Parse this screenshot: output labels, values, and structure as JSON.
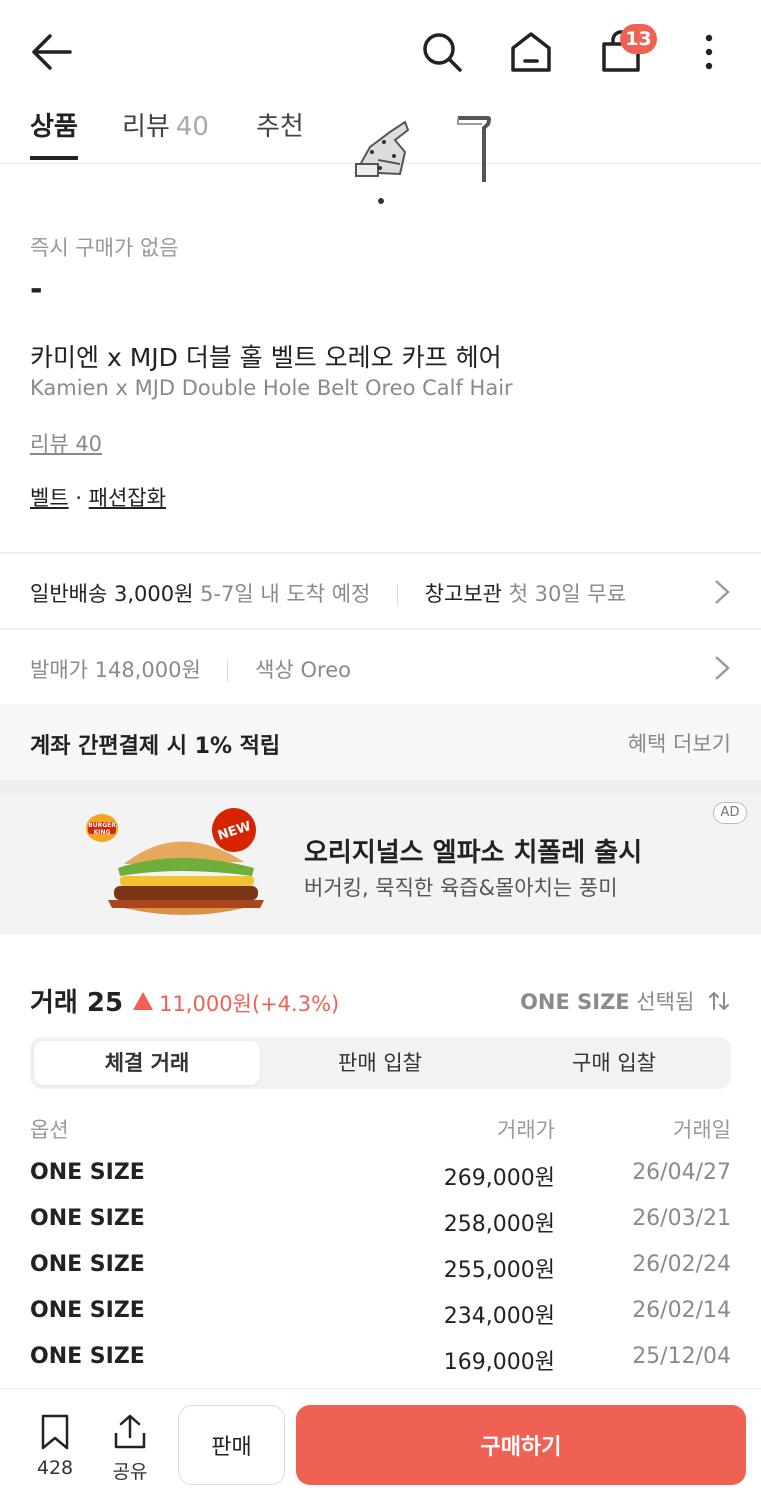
{
  "header": {
    "cart_count": "13"
  },
  "tabs": [
    {
      "label": "상품"
    },
    {
      "label": "리뷰",
      "count": "40"
    },
    {
      "label": "추천"
    }
  ],
  "product": {
    "price_label": "즉시 구매가 없음",
    "price_value": "-",
    "name_ko": "카미엔 x MJD 더블 홀 벨트 오레오 카프 헤어",
    "name_en": "Kamien x MJD Double Hole Belt Oreo Calf Hair",
    "review_link": "리뷰 40",
    "category_1": "벨트",
    "category_sep": " · ",
    "category_2": "패션잡화"
  },
  "shipping": {
    "normal_label": "일반배송 3,000원",
    "normal_eta": "5-7일 내 도착 예정",
    "storage_label": "창고보관",
    "storage_note": "첫 30일 무료"
  },
  "specs": {
    "release_price": "발매가 148,000원",
    "color": "색상 Oreo"
  },
  "benefit": {
    "text": "계좌 간편결제 시 1% 적립",
    "more": "혜택 더보기"
  },
  "ad": {
    "badge": "AD",
    "title": "오리지널스 엘파소 치폴레 출시",
    "subtitle": "버거킹, 묵직한 육즙&몰아치는 풍미",
    "brand_text": "BURGER KING",
    "new_text": "NEW"
  },
  "trades": {
    "title": "거래 25",
    "change": "11,000원(+4.3%)",
    "size_selected": "ONE SIZE",
    "size_suffix": "선택됨",
    "tabs": [
      "체결 거래",
      "판매 입찰",
      "구매 입찰"
    ],
    "columns": [
      "옵션",
      "거래가",
      "거래일"
    ],
    "rows": [
      {
        "option": "ONE SIZE",
        "price": "269,000원",
        "date": "26/04/27"
      },
      {
        "option": "ONE SIZE",
        "price": "258,000원",
        "date": "26/03/21"
      },
      {
        "option": "ONE SIZE",
        "price": "255,000원",
        "date": "26/02/24"
      },
      {
        "option": "ONE SIZE",
        "price": "234,000원",
        "date": "26/02/14"
      },
      {
        "option": "ONE SIZE",
        "price": "169,000원",
        "date": "25/12/04"
      }
    ]
  },
  "bottom": {
    "bookmark_count": "428",
    "share_label": "공유",
    "sell_label": "판매",
    "buy_label": "구매하기"
  },
  "colors": {
    "accent": "#ef6253"
  }
}
